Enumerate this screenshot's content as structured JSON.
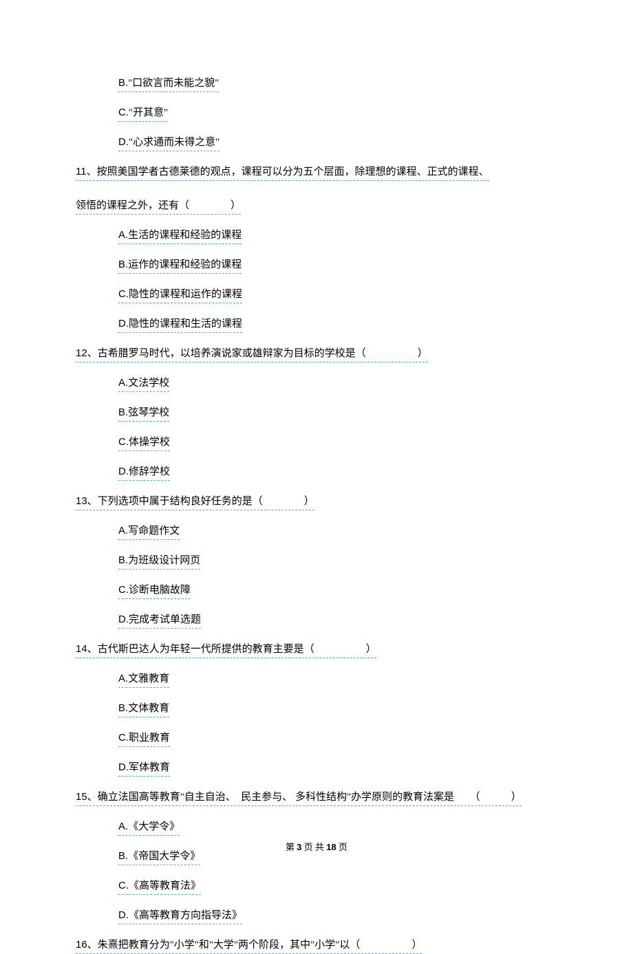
{
  "orphan_options": [
    {
      "letter": "B.",
      "text": "\"口欲言而未能之貌\""
    },
    {
      "letter": "C.",
      "text": "\"开其意\""
    },
    {
      "letter": "D.",
      "text": "\"心求通而未得之意\""
    }
  ],
  "questions": [
    {
      "num": "11、",
      "text_line1": "按照美国学者古德莱德的观点，课程可以分为五个层面，除理想的课程、正式的课程、",
      "text_line2_pre": "领悟的课程之外，还有（",
      "text_line2_post": "）",
      "options": [
        {
          "letter": "A.",
          "text": "生活的课程和经验的课程"
        },
        {
          "letter": "B.",
          "text": "运作的课程和经验的课程"
        },
        {
          "letter": "C.",
          "text": "隐性的课程和运作的课程"
        },
        {
          "letter": "D.",
          "text": "隐性的课程和生活的课程"
        }
      ]
    },
    {
      "num": "12、",
      "text_pre": "古希腊罗马时代，以培养演说家或雄辩家为目标的学校是（",
      "text_post": "）",
      "options": [
        {
          "letter": "A.",
          "text": "文法学校"
        },
        {
          "letter": "B.",
          "text": "弦琴学校"
        },
        {
          "letter": "C.",
          "text": "体操学校"
        },
        {
          "letter": "D.",
          "text": "修辞学校"
        }
      ]
    },
    {
      "num": "13、",
      "text_pre": "下列选项中属于结构良好任务的是（",
      "text_post": "）",
      "options": [
        {
          "letter": "A.",
          "text": "写命题作文"
        },
        {
          "letter": "B.",
          "text": "为班级设计网页"
        },
        {
          "letter": "C.",
          "text": "诊断电脑故障"
        },
        {
          "letter": "D.",
          "text": "完成考试单选题"
        }
      ]
    },
    {
      "num": "14、",
      "text_pre": "古代斯巴达人为年轻一代所提供的教育主要是（",
      "text_post": "）",
      "options": [
        {
          "letter": "A.",
          "text": "文雅教育"
        },
        {
          "letter": "B.",
          "text": "文体教育"
        },
        {
          "letter": "C.",
          "text": "职业教育"
        },
        {
          "letter": "D.",
          "text": "军体教育"
        }
      ]
    },
    {
      "num": "15、",
      "text_pre": "确立法国高等教育\"自主自治、　民主参与、 多科性结构\"办学原则的教育法案是　　（",
      "text_post": "）",
      "options": [
        {
          "letter": "A.",
          "text": "《大学令》"
        },
        {
          "letter": "B.",
          "text": "《帝国大学令》"
        },
        {
          "letter": "C.",
          "text": "《高等教育法》"
        },
        {
          "letter": "D.",
          "text": "《高等教育方向指导法》"
        }
      ]
    },
    {
      "num": "16、",
      "text_pre": "朱熹把教育分为\"小学\"和\"大学\"两个阶段，其中\"小学\"以（",
      "text_post": "）",
      "no_options": true
    }
  ],
  "footer": {
    "pre": "第 ",
    "current": "3",
    "mid": " 页 共 ",
    "total": "18",
    "post": " 页"
  }
}
